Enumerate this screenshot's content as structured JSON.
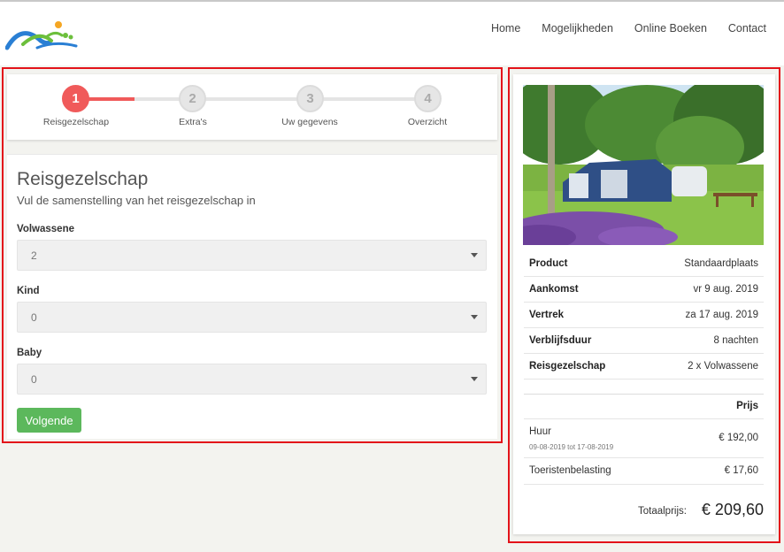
{
  "nav": {
    "items": [
      "Home",
      "Mogelijkheden",
      "Online Boeken",
      "Contact"
    ]
  },
  "steps": [
    {
      "number": "1",
      "label": "Reisgezelschap",
      "active": true
    },
    {
      "number": "2",
      "label": "Extra's",
      "active": false
    },
    {
      "number": "3",
      "label": "Uw gegevens",
      "active": false
    },
    {
      "number": "4",
      "label": "Overzicht",
      "active": false
    }
  ],
  "form": {
    "title": "Reisgezelschap",
    "subtitle": "Vul de samenstelling van het reisgezelschap in",
    "fields": [
      {
        "label": "Volwassene",
        "value": "2"
      },
      {
        "label": "Kind",
        "value": "0"
      },
      {
        "label": "Baby",
        "value": "0"
      }
    ],
    "next_button": "Volgende"
  },
  "summary": {
    "rows": [
      {
        "key": "Product",
        "value": "Standaardplaats"
      },
      {
        "key": "Aankomst",
        "value": "vr 9 aug. 2019"
      },
      {
        "key": "Vertrek",
        "value": "za 17 aug. 2019"
      },
      {
        "key": "Verblijfsduur",
        "value": "8 nachten"
      },
      {
        "key": "Reisgezelschap",
        "value": "2 x Volwassene"
      }
    ],
    "price_header": "Prijs",
    "prices": [
      {
        "name": "Huur",
        "dates": "09-08-2019 tot 17-08-2019",
        "amount": "€ 192,00"
      },
      {
        "name": "Toeristenbelasting",
        "dates": "",
        "amount": "€ 17,60"
      }
    ],
    "total_label": "Totaalprijs:",
    "total_value": "€ 209,60"
  },
  "colors": {
    "accent": "#f05a5a",
    "button": "#5cb85c",
    "highlight_outline": "#e3131a"
  }
}
